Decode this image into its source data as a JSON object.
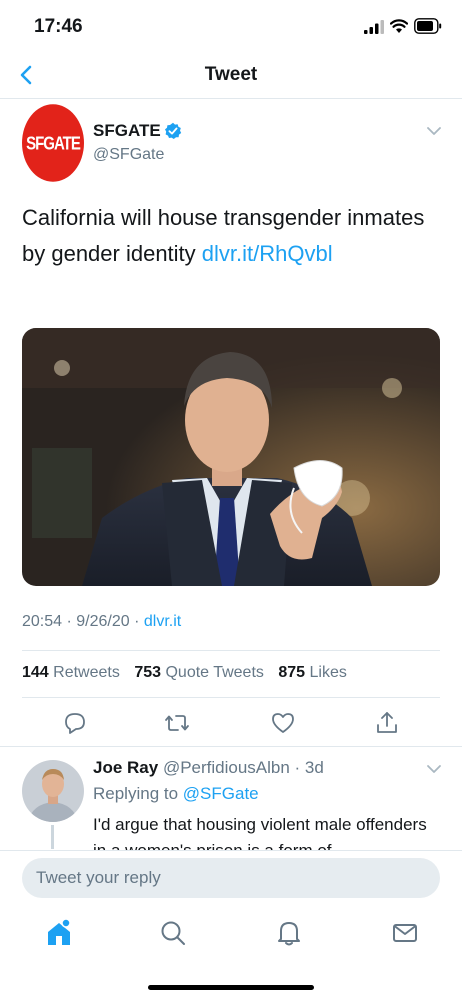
{
  "status_bar": {
    "time": "17:46"
  },
  "nav": {
    "title": "Tweet"
  },
  "tweet": {
    "author_name": "SFGATE",
    "author_handle": "@SFGate",
    "logo_text": "SFGATE",
    "text": "California will house transgender inmates by gender identity ",
    "link": "dlvr.it/RhQvbl",
    "time": "20:54 · 9/26/20 · ",
    "source": "dlvr.it",
    "retweets": "144",
    "retweets_label": "Retweets",
    "quote_tweets": "753",
    "quote_tweets_label": "Quote Tweets",
    "likes": "875",
    "likes_label": "Likes"
  },
  "reply": {
    "name": "Joe Ray",
    "handle_time": "@PerfidiousAlbn · 3d",
    "replying_prefix": "Replying to ",
    "replying_to": "@SFGate",
    "text": "I'd argue that housing violent male offenders in a women's prison is a form of"
  },
  "compose": {
    "placeholder": "Tweet your reply"
  },
  "colors": {
    "accent": "#1da1f2",
    "brand_red": "#e2231a",
    "muted": "#657786"
  },
  "icons": [
    "back-icon",
    "verified-icon",
    "chevron-down-icon",
    "reply-icon",
    "retweet-icon",
    "like-icon",
    "share-icon",
    "home-icon",
    "search-icon",
    "notifications-icon",
    "messages-icon"
  ]
}
